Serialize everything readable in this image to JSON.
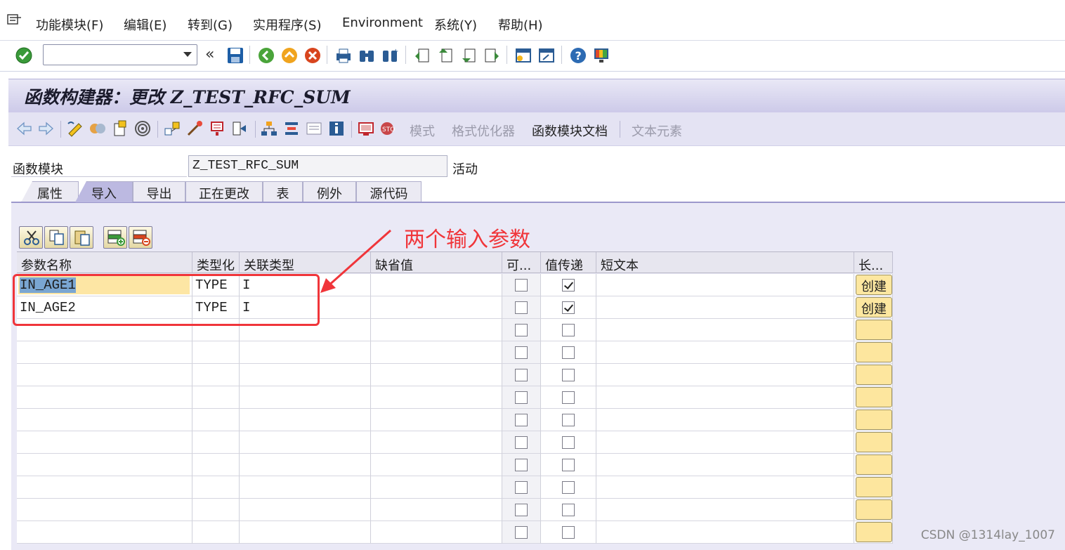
{
  "menu": {
    "items": [
      "功能模块(F)",
      "编辑(E)",
      "转到(G)",
      "实用程序(S)",
      "Environment",
      "系统(Y)",
      "帮助(H)"
    ]
  },
  "standard_toolbar": {
    "command_field_value": "",
    "icons": [
      "enter-icon",
      "dropdown-icon",
      "back-double-icon",
      "save-icon",
      "back-icon",
      "exit-icon",
      "cancel-icon",
      "print-icon",
      "find-icon",
      "find-next-icon",
      "first-page-icon",
      "previous-page-icon",
      "next-page-icon",
      "last-page-icon",
      "create-session-icon",
      "shortcut-icon",
      "help-icon",
      "customize-layout-icon"
    ]
  },
  "title": "函数构建器：更改 Z_TEST_RFC_SUM",
  "app_toolbar": {
    "buttons": [
      {
        "label": "模式",
        "enabled": false
      },
      {
        "label": "格式优化器",
        "enabled": false
      },
      {
        "label": "函数模块文档",
        "enabled": true
      },
      {
        "label": "文本元素",
        "enabled": false
      }
    ]
  },
  "function_module": {
    "label": "函数模块",
    "value": "Z_TEST_RFC_SUM",
    "status": "活动"
  },
  "tabs": [
    {
      "label": "属性",
      "active": false
    },
    {
      "label": "导入",
      "active": true
    },
    {
      "label": "导出",
      "active": false
    },
    {
      "label": "正在更改",
      "active": false
    },
    {
      "label": "表",
      "active": false
    },
    {
      "label": "例外",
      "active": false
    },
    {
      "label": "源代码",
      "active": false
    }
  ],
  "table": {
    "columns": [
      "参数名称",
      "类型化",
      "关联类型",
      "缺省值",
      "可...",
      "值传递",
      "短文本",
      "长..."
    ],
    "create_label": "创建",
    "rows": [
      {
        "param": "IN_AGE1",
        "typing": "TYPE",
        "ref_type": "I",
        "default": "",
        "optional": false,
        "pass_by_value": true,
        "short_text": "",
        "long_text": "创建"
      },
      {
        "param": "IN_AGE2",
        "typing": "TYPE",
        "ref_type": "I",
        "default": "",
        "optional": false,
        "pass_by_value": true,
        "short_text": "",
        "long_text": "创建"
      },
      {
        "param": "",
        "typing": "",
        "ref_type": "",
        "default": "",
        "optional": false,
        "pass_by_value": false,
        "short_text": "",
        "long_text": ""
      },
      {
        "param": "",
        "typing": "",
        "ref_type": "",
        "default": "",
        "optional": false,
        "pass_by_value": false,
        "short_text": "",
        "long_text": ""
      },
      {
        "param": "",
        "typing": "",
        "ref_type": "",
        "default": "",
        "optional": false,
        "pass_by_value": false,
        "short_text": "",
        "long_text": ""
      },
      {
        "param": "",
        "typing": "",
        "ref_type": "",
        "default": "",
        "optional": false,
        "pass_by_value": false,
        "short_text": "",
        "long_text": ""
      },
      {
        "param": "",
        "typing": "",
        "ref_type": "",
        "default": "",
        "optional": false,
        "pass_by_value": false,
        "short_text": "",
        "long_text": ""
      },
      {
        "param": "",
        "typing": "",
        "ref_type": "",
        "default": "",
        "optional": false,
        "pass_by_value": false,
        "short_text": "",
        "long_text": ""
      },
      {
        "param": "",
        "typing": "",
        "ref_type": "",
        "default": "",
        "optional": false,
        "pass_by_value": false,
        "short_text": "",
        "long_text": ""
      },
      {
        "param": "",
        "typing": "",
        "ref_type": "",
        "default": "",
        "optional": false,
        "pass_by_value": false,
        "short_text": "",
        "long_text": ""
      },
      {
        "param": "",
        "typing": "",
        "ref_type": "",
        "default": "",
        "optional": false,
        "pass_by_value": false,
        "short_text": "",
        "long_text": ""
      },
      {
        "param": "",
        "typing": "",
        "ref_type": "",
        "default": "",
        "optional": false,
        "pass_by_value": false,
        "short_text": "",
        "long_text": ""
      }
    ]
  },
  "annotation": {
    "text": "两个输入参数",
    "color": "#f0353a"
  },
  "watermark": "CSDN @1314lay_1007",
  "colors": {
    "title_bar": "#cdcae9",
    "active_tab": "#bcb9e1",
    "create_button": "#fde7a0"
  }
}
